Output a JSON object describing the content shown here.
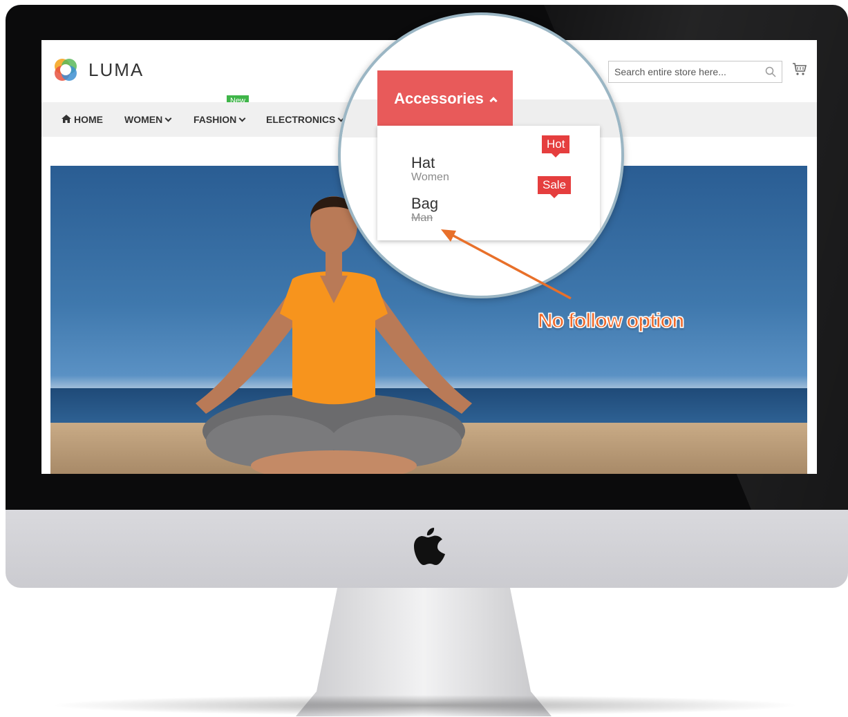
{
  "header": {
    "logo_text": "LUMA",
    "search_placeholder": "Search entire store here..."
  },
  "nav": {
    "items": [
      {
        "label": "HOME"
      },
      {
        "label": "WOMEN"
      },
      {
        "label": "FASHION",
        "badge": "New"
      },
      {
        "label": "ELECTRONICS"
      }
    ]
  },
  "callout": {
    "menu_label": "Accessories",
    "dropdown": [
      {
        "title": "Hat",
        "subtitle": "Women",
        "badge": "Hot"
      },
      {
        "title": "Bag",
        "subtitle": "Man",
        "badge": "Sale",
        "subtitle_struck": true
      }
    ],
    "annotation": "No follow option"
  },
  "colors": {
    "accent_red": "#e85a5a",
    "new_badge": "#3fb549",
    "annotation": "#f06a2a"
  },
  "icons": [
    "home-icon",
    "chevron-down-icon",
    "search-icon",
    "cart-icon",
    "chevron-up-icon",
    "apple-logo-icon",
    "luma-logo-icon",
    "arrow-icon"
  ]
}
